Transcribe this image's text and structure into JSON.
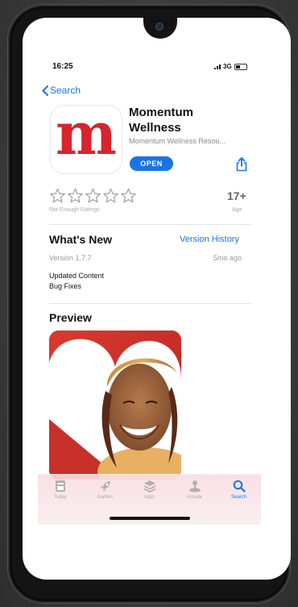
{
  "status_bar": {
    "time": "16:25",
    "network": "3G"
  },
  "nav": {
    "back_label": "Search"
  },
  "app": {
    "name_line1": "Momentum",
    "name_line2": "Wellness",
    "subtitle": "Momentum Wellness Resou...",
    "open_label": "OPEN",
    "icon_letter": "m",
    "brand_color": "#d8242e",
    "accent_color": "#1a73e8"
  },
  "ratings": {
    "stars": 0,
    "label": "Not Enough Ratings",
    "age": "17+",
    "age_label": "Age"
  },
  "whats_new": {
    "title": "What's New",
    "history_link": "Version History",
    "version": "Version 1.7.7",
    "ago": "5mo ago",
    "notes": [
      "Updated Content",
      "Bug Fixes"
    ]
  },
  "preview": {
    "title": "Preview"
  },
  "tabbar": {
    "tabs": [
      {
        "label": "Today",
        "icon": "today-icon",
        "active": false
      },
      {
        "label": "Games",
        "icon": "rocket-icon",
        "active": false
      },
      {
        "label": "Apps",
        "icon": "layers-icon",
        "active": false
      },
      {
        "label": "Arcade",
        "icon": "joystick-icon",
        "active": false
      },
      {
        "label": "Search",
        "icon": "search-icon",
        "active": true
      }
    ]
  }
}
